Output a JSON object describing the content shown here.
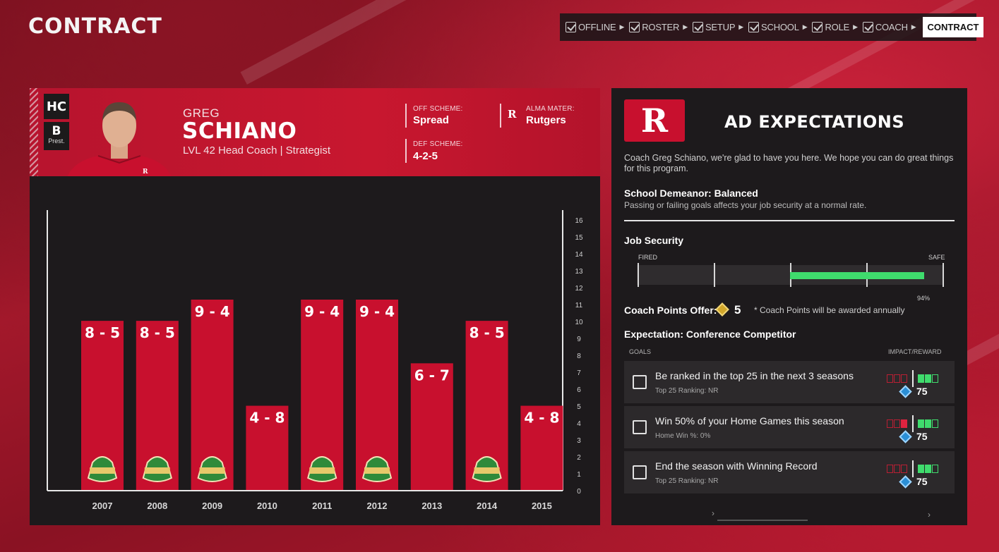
{
  "page": {
    "title": "CONTRACT"
  },
  "steps": {
    "items": [
      {
        "label": "OFFLINE"
      },
      {
        "label": "ROSTER"
      },
      {
        "label": "SETUP"
      },
      {
        "label": "SCHOOL"
      },
      {
        "label": "ROLE"
      },
      {
        "label": "COACH"
      }
    ],
    "active": "CONTRACT"
  },
  "coach": {
    "position": "HC",
    "grade": "B",
    "grade_label": "Prest.",
    "first_name": "GREG",
    "last_name": "SCHIANO",
    "subtitle": "LVL 42 Head Coach | Strategist",
    "off_scheme_label": "OFF SCHEME:",
    "off_scheme": "Spread",
    "def_scheme_label": "DEF SCHEME:",
    "def_scheme": "4-2-5",
    "alma_mater_label": "ALMA MATER:",
    "alma_mater": "Rutgers",
    "school_mark": "R"
  },
  "chart_data": {
    "type": "bar",
    "categories": [
      "2007",
      "2008",
      "2009",
      "2010",
      "2011",
      "2012",
      "2013",
      "2014",
      "2015"
    ],
    "values": [
      8,
      8,
      9,
      4,
      9,
      9,
      6,
      8,
      4
    ],
    "bar_labels": [
      "8 - 5",
      "8 - 5",
      "9 - 4",
      "4 - 8",
      "9 - 4",
      "9 - 4",
      "6 - 7",
      "8 - 5",
      "4 - 8"
    ],
    "bowl_game": [
      true,
      true,
      true,
      false,
      true,
      true,
      false,
      true,
      false
    ],
    "y_ticks": [
      "0",
      "1",
      "2",
      "3",
      "4",
      "5",
      "6",
      "7",
      "8",
      "9",
      "10",
      "11",
      "12",
      "13",
      "14",
      "15",
      "16"
    ],
    "ylim": [
      0,
      16
    ],
    "bar_color": "#c8102e"
  },
  "ad": {
    "logo": "R",
    "title": "AD EXPECTATIONS",
    "intro": "Coach Greg Schiano, we're glad to have you here. We hope you can do great things for this program.",
    "demeanor_title": "School Demeanor: Balanced",
    "demeanor_desc": "Passing or failing goals affects your job security at a normal rate.",
    "job_security": {
      "title": "Job Security",
      "left_label": "FIRED",
      "right_label": "SAFE",
      "value_label": "94%",
      "fill_start": 0.5,
      "fill_end": 0.94,
      "fill_color": "#3fdc6d"
    },
    "coach_points": {
      "label": "Coach Points Offer:",
      "value": "5",
      "note": "* Coach Points will be awarded annually"
    },
    "expectation": "Expectation: Conference Competitor",
    "columns": {
      "goals": "GOALS",
      "impact": "IMPACT/REWARD"
    },
    "goals": [
      {
        "text": "Be ranked in the top 25 in the next 3 seasons",
        "sub": "Top 25 Ranking: NR",
        "points": "75",
        "red_filled": 0,
        "green_filled": 2
      },
      {
        "text": "Win 50% of your Home Games this season",
        "sub": "Home Win %: 0%",
        "points": "75",
        "red_filled": 1,
        "green_filled": 2
      },
      {
        "text": "End the season with Winning Record",
        "sub": "Top 25 Ranking: NR",
        "points": "75",
        "red_filled": 0,
        "green_filled": 2
      }
    ]
  }
}
